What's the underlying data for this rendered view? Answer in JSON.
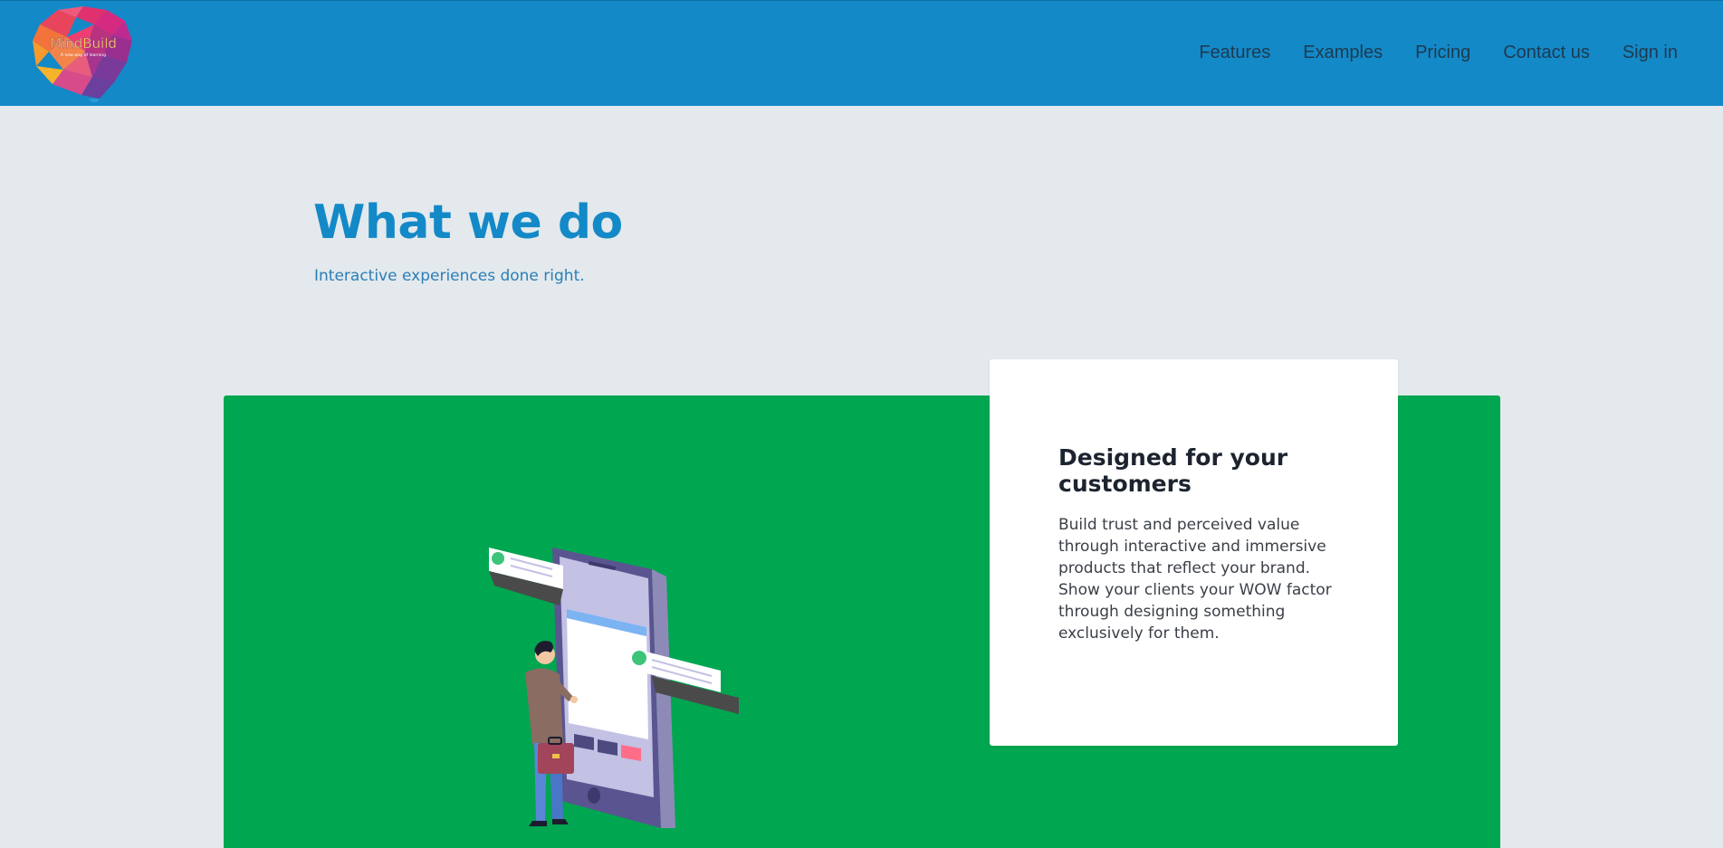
{
  "header": {
    "logo": {
      "wordmark": "MindBuild",
      "tagline": "A new way of learning"
    },
    "nav": [
      {
        "label": "Features"
      },
      {
        "label": "Examples"
      },
      {
        "label": "Pricing"
      },
      {
        "label": "Contact us"
      },
      {
        "label": "Sign in"
      }
    ]
  },
  "hero": {
    "title": "What we do",
    "subtitle": "Interactive experiences done right."
  },
  "feature": {
    "title": "Designed for your customers",
    "body": "Build trust and perceived value through interactive and immersive products that reflect your brand. Show your clients your WOW factor through designing something exclusively for them."
  },
  "colors": {
    "header_bg": "#1389c8",
    "page_bg": "#e3e9ec",
    "accent_green": "#00a650",
    "title_blue": "#1389c8"
  }
}
